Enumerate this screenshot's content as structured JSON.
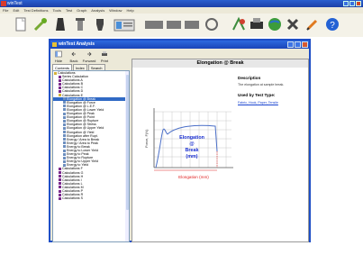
{
  "app": {
    "title": "winTest",
    "menus": [
      "File",
      "Edit",
      "Test Definitions",
      "Tools",
      "Test",
      "Graph",
      "Analysis",
      "Window",
      "Help"
    ]
  },
  "dialog": {
    "title": "winTest Analysis",
    "nav": [
      "Hide",
      "Back",
      "Forward",
      "Print"
    ],
    "tabs": [
      "Contents",
      "Index",
      "Search"
    ],
    "tree": [
      {
        "label": "Calculations",
        "level": 0,
        "icon": "book-open-icon"
      },
      {
        "label": "Series Calculation",
        "level": 1,
        "icon": "topic-icon"
      },
      {
        "label": "Calculations A",
        "level": 1,
        "icon": "topic-icon"
      },
      {
        "label": "Calculations B",
        "level": 1,
        "icon": "topic-icon"
      },
      {
        "label": "Calculations C",
        "level": 1,
        "icon": "topic-icon"
      },
      {
        "label": "Calculations D",
        "level": 1,
        "icon": "topic-icon"
      },
      {
        "label": "Calculations E",
        "level": 1,
        "icon": "book-open-icon"
      },
      {
        "label": "Elongation @ Break",
        "level": 2,
        "icon": "page-icon",
        "selected": true
      },
      {
        "label": "Elongation @ Force",
        "level": 2,
        "icon": "page-icon"
      },
      {
        "label": "Elongation @ L.E.F.",
        "level": 2,
        "icon": "page-icon"
      },
      {
        "label": "Elongation @ Lower Yield",
        "level": 2,
        "icon": "page-icon"
      },
      {
        "label": "Elongation @ Peak",
        "level": 2,
        "icon": "page-icon"
      },
      {
        "label": "Elongation @ Point",
        "level": 2,
        "icon": "page-icon"
      },
      {
        "label": "Elongation @ Rupture",
        "level": 2,
        "icon": "page-icon"
      },
      {
        "label": "Elongation @ Stress",
        "level": 2,
        "icon": "page-icon"
      },
      {
        "label": "Elongation @ Upper Yield",
        "level": 2,
        "icon": "page-icon"
      },
      {
        "label": "Elongation @ Yield",
        "level": 2,
        "icon": "page-icon"
      },
      {
        "label": "Elongation after Rupt.",
        "level": 2,
        "icon": "page-icon"
      },
      {
        "label": "Energy / Area to Break",
        "level": 2,
        "icon": "page-icon"
      },
      {
        "label": "Energy / Area to Peak",
        "level": 2,
        "icon": "page-icon"
      },
      {
        "label": "Energy to Break",
        "level": 2,
        "icon": "page-icon"
      },
      {
        "label": "Energy to Lower Yield",
        "level": 2,
        "icon": "page-icon"
      },
      {
        "label": "Energy to Peak",
        "level": 2,
        "icon": "page-icon"
      },
      {
        "label": "Energy to Rupture",
        "level": 2,
        "icon": "page-icon"
      },
      {
        "label": "Energy to Upper Yield",
        "level": 2,
        "icon": "page-icon"
      },
      {
        "label": "Energy to Yield",
        "level": 2,
        "icon": "page-icon"
      },
      {
        "label": "Calculations F",
        "level": 1,
        "icon": "topic-icon"
      },
      {
        "label": "Calculations G",
        "level": 1,
        "icon": "topic-icon"
      },
      {
        "label": "Calculations H",
        "level": 1,
        "icon": "topic-icon"
      },
      {
        "label": "Calculations I",
        "level": 1,
        "icon": "topic-icon"
      },
      {
        "label": "Calculations L",
        "level": 1,
        "icon": "topic-icon"
      },
      {
        "label": "Calculations M",
        "level": 1,
        "icon": "topic-icon"
      },
      {
        "label": "Calculations P",
        "level": 1,
        "icon": "topic-icon"
      },
      {
        "label": "Calculations R",
        "level": 1,
        "icon": "topic-icon"
      },
      {
        "label": "Calculations S",
        "level": 1,
        "icon": "topic-icon"
      }
    ],
    "content": {
      "title": "Elongation @ Break",
      "description_heading": "Description",
      "description_text": "The elongation at sample break.",
      "used_by_heading": "Used by Test Type:",
      "used_by_links": "Fabric, Hook, Paper, Tensile",
      "chart_ylabel": "Force, F(N)",
      "chart_xlabel": "Elongation (mm)",
      "chart_annotation": [
        "Elongation",
        "@",
        "Break",
        "(mm)"
      ]
    }
  },
  "colors": {
    "accent": "#1f4fc6",
    "selection": "#316ac5",
    "link": "#1a44d0",
    "axis_label": "#e02020",
    "annotation": "#1a2fd0"
  }
}
